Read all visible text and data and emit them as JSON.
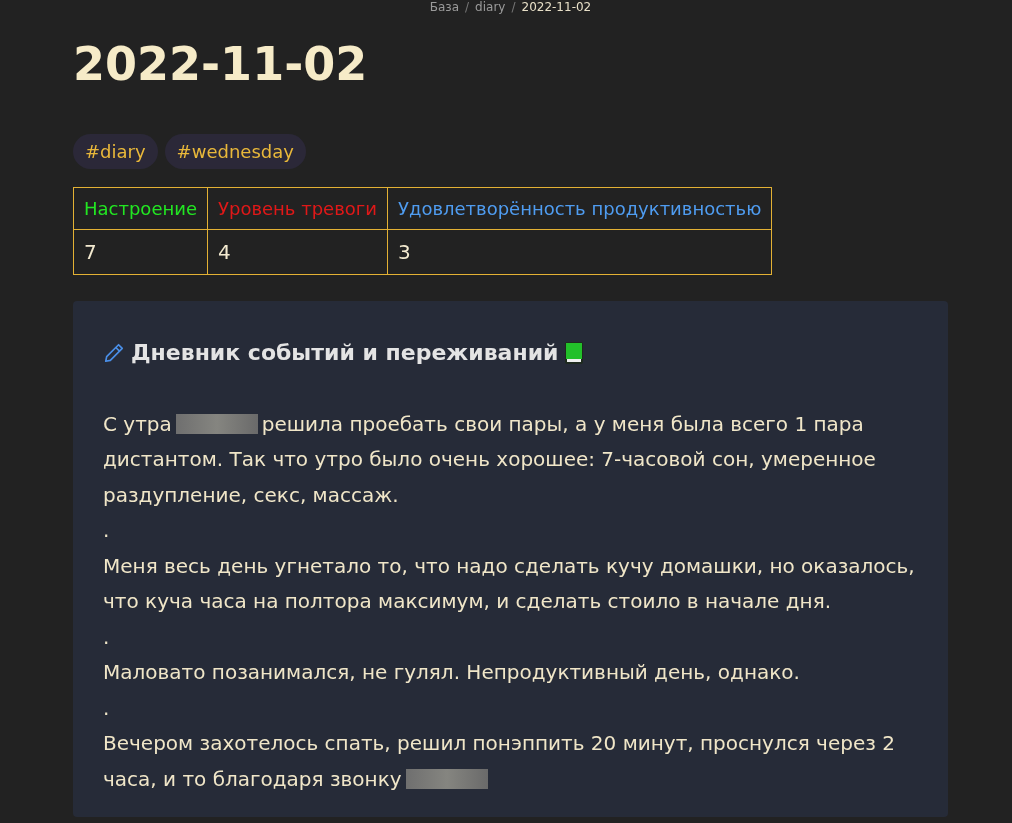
{
  "breadcrumb": [
    {
      "kind": "link",
      "text": "База"
    },
    {
      "kind": "separator",
      "text": "/"
    },
    {
      "kind": "link",
      "text": "diary"
    },
    {
      "kind": "separator",
      "text": "/"
    },
    {
      "kind": "current",
      "text": "2022-11-02"
    }
  ],
  "title": "2022-11-02",
  "tags": [
    "#diary",
    "#wednesday"
  ],
  "table": {
    "columns": [
      {
        "label": "Настроение",
        "color": "#22e622"
      },
      {
        "label": "Уровень тревоги",
        "color": "#e01818"
      },
      {
        "label": "Удовлетворённость продуктивностью",
        "color": "#4f9cf0"
      }
    ],
    "rows": [
      [
        "7",
        "4",
        "3"
      ]
    ]
  },
  "callout": {
    "title": "Дневник событий и переживаний",
    "lines": [
      [
        {
          "kind": "text",
          "text": "С утра"
        },
        {
          "kind": "redacted"
        },
        {
          "kind": "text",
          "text": "решила проебать свои пары, а у меня была всего 1 пара"
        }
      ],
      [
        {
          "kind": "text",
          "text": "дистантом. Так что утро было очень хорошее: 7-часовой сон, умеренное"
        }
      ],
      [
        {
          "kind": "text",
          "text": "раздупление, секс, массаж."
        }
      ],
      [
        {
          "kind": "text",
          "text": "."
        }
      ],
      [
        {
          "kind": "text",
          "text": "Меня весь день угнетало то, что надо сделать кучу домашки, но оказалось,"
        }
      ],
      [
        {
          "kind": "text",
          "text": "что куча часа на полтора максимум, и сделать стоило в начале дня."
        }
      ],
      [
        {
          "kind": "text",
          "text": "."
        }
      ],
      [
        {
          "kind": "text",
          "text": "Маловато позанимался, не гулял. Непродуктивный день, однако."
        }
      ],
      [
        {
          "kind": "text",
          "text": "."
        }
      ],
      [
        {
          "kind": "text",
          "text": "Вечером захотелось спать, решил понэппить 20 минут, проснулся через 2"
        }
      ],
      [
        {
          "kind": "text",
          "text": "часа, и то благодаря звонку"
        },
        {
          "kind": "redacted"
        }
      ]
    ]
  }
}
